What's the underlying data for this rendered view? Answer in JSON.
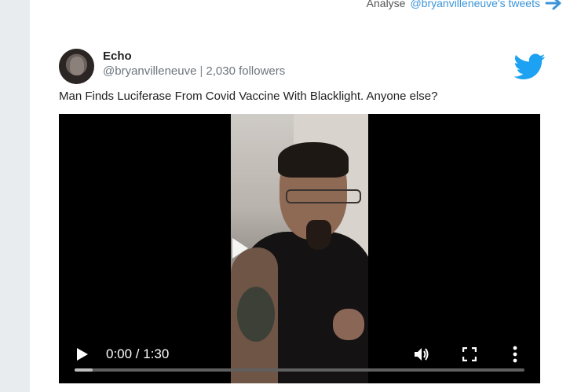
{
  "top_link": {
    "prefix": "Analyse",
    "handle": "@bryanvilleneuve's tweets"
  },
  "tweet": {
    "author_name": "Echo",
    "handle": "@bryanvilleneuve",
    "separator": "|",
    "followers": "2,030 followers",
    "text": "Man Finds Luciferase From Covid Vaccine With Blacklight. Anyone else?"
  },
  "video": {
    "time_display": "0:00 / 1:30",
    "progress": 0.04
  },
  "icons": {
    "arrow": "arrow-right-icon",
    "bird": "twitter-bird-icon",
    "play": "play-icon",
    "volume": "volume-icon",
    "fullscreen": "fullscreen-icon",
    "more": "more-vertical-icon"
  },
  "colors": {
    "link": "#3b94d9",
    "twitter_blue": "#1da1f2",
    "page_bg": "#e9ecef"
  }
}
